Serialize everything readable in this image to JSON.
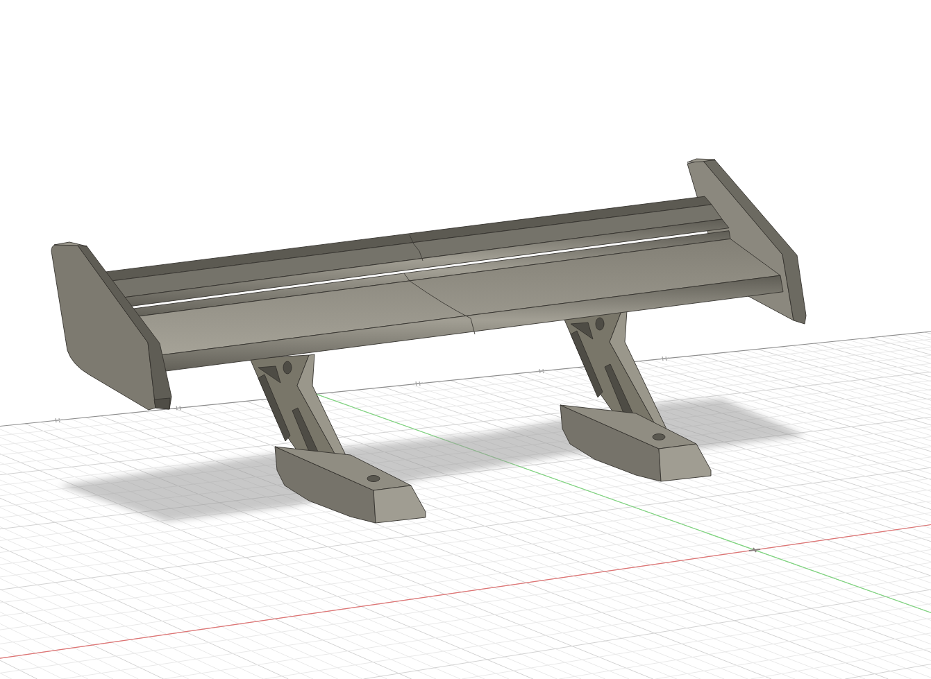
{
  "viewport": {
    "axes": [
      {
        "kind": "x",
        "color": "#e07272"
      },
      {
        "kind": "y",
        "color": "#7fd67f"
      }
    ]
  }
}
